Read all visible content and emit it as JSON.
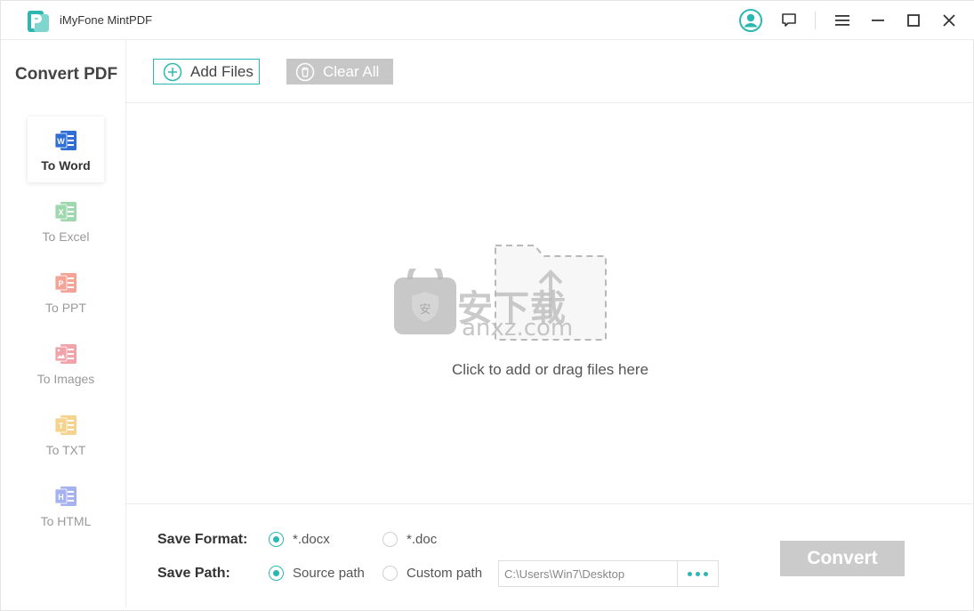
{
  "app": {
    "title": "iMyFone MintPDF"
  },
  "sidebar": {
    "title": "Convert PDF",
    "items": [
      {
        "label": "To Word",
        "icon": "word-icon",
        "color": "#2f6fd4",
        "active": true
      },
      {
        "label": "To Excel",
        "icon": "excel-icon",
        "color": "#9fd8ae",
        "active": false
      },
      {
        "label": "To PPT",
        "icon": "ppt-icon",
        "color": "#f3a497",
        "active": false
      },
      {
        "label": "To Images",
        "icon": "images-icon",
        "color": "#f1a3a9",
        "active": false
      },
      {
        "label": "To TXT",
        "icon": "txt-icon",
        "color": "#f6d38c",
        "active": false
      },
      {
        "label": "To HTML",
        "icon": "html-icon",
        "color": "#a6b1ef",
        "active": false
      }
    ]
  },
  "toolbar": {
    "add_label": "Add Files",
    "clear_label": "Clear All"
  },
  "dropzone": {
    "text": "Click to add or drag files here",
    "watermark_cn": "安下载",
    "watermark_en": "anxz.com"
  },
  "bottom": {
    "format_label": "Save Format:",
    "path_label": "Save Path:",
    "format_options": [
      {
        "label": "*.docx",
        "selected": true
      },
      {
        "label": "*.doc",
        "selected": false
      }
    ],
    "path_options": [
      {
        "label": "Source path",
        "selected": true
      },
      {
        "label": "Custom path",
        "selected": false
      }
    ],
    "path_value": "C:\\Users\\Win7\\Desktop",
    "convert_label": "Convert"
  },
  "colors": {
    "accent": "#2cb8b0",
    "disabled": "#c7c7c7"
  }
}
